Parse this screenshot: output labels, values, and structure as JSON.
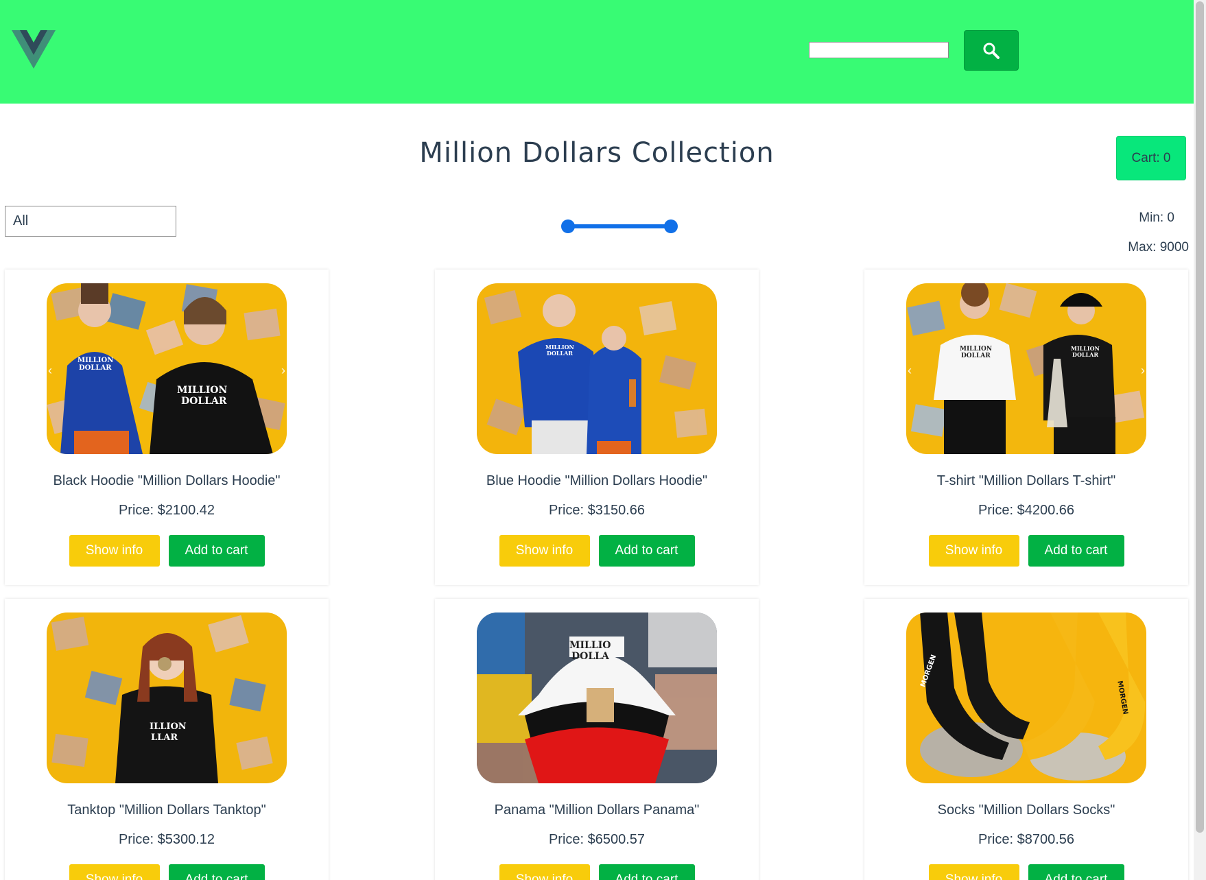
{
  "header": {
    "search": {
      "value": "",
      "placeholder": ""
    },
    "colors": {
      "background": "#38fb74",
      "button": "#02b144"
    }
  },
  "main": {
    "title": "Million Dollars Collection",
    "cart_label": "Cart: 0"
  },
  "filters": {
    "category_selected": "All",
    "price_range": {
      "low": 0,
      "high": 9000
    },
    "min_label": "Min: 0",
    "max_label": "Max: 9000"
  },
  "products": [
    {
      "name": "Black Hoodie \"Million Dollars Hoodie\"",
      "price": "Price: $2100.42",
      "info_label": "Show info",
      "cart_label": "Add to cart"
    },
    {
      "name": "Blue Hoodie \"Million Dollars Hoodie\"",
      "price": "Price: $3150.66",
      "info_label": "Show info",
      "cart_label": "Add to cart"
    },
    {
      "name": "T-shirt \"Million Dollars T-shirt\"",
      "price": "Price: $4200.66",
      "info_label": "Show info",
      "cart_label": "Add to cart"
    },
    {
      "name": "Tanktop \"Million Dollars Tanktop\"",
      "price": "Price: $5300.12",
      "info_label": "Show info",
      "cart_label": "Add to cart"
    },
    {
      "name": "Panama \"Million Dollars Panama\"",
      "price": "Price: $6500.57",
      "info_label": "Show info",
      "cart_label": "Add to cart"
    },
    {
      "name": "Socks \"Million Dollars Socks\"",
      "price": "Price: $8700.56",
      "info_label": "Show info",
      "cart_label": "Add to cart"
    }
  ],
  "icons": {
    "logo": "vue-logo-icon",
    "search": "search-icon",
    "carousel_prev": "chevron-left-icon",
    "carousel_next": "chevron-right-icon"
  }
}
